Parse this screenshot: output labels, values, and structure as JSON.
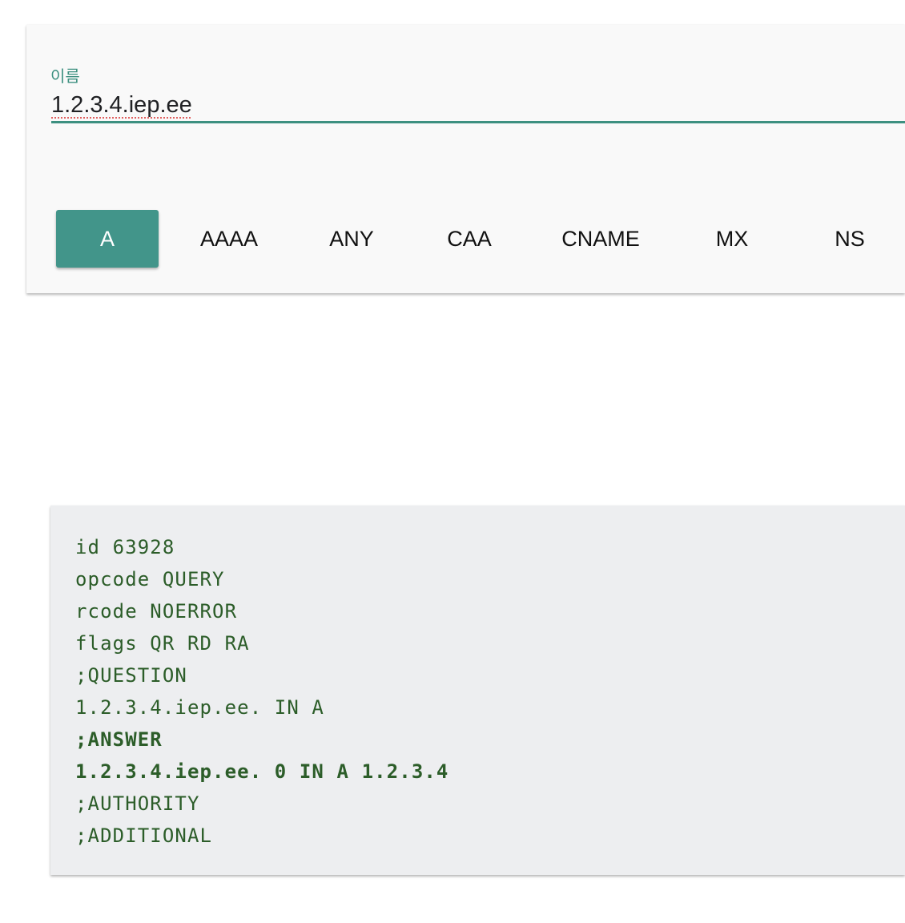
{
  "query_form": {
    "name_label": "이름",
    "name_value": "1.2.3.4.iep.ee",
    "record_types": [
      {
        "label": "A",
        "selected": true
      },
      {
        "label": "AAAA",
        "selected": false
      },
      {
        "label": "ANY",
        "selected": false
      },
      {
        "label": "CAA",
        "selected": false
      },
      {
        "label": "CNAME",
        "selected": false
      },
      {
        "label": "MX",
        "selected": false
      },
      {
        "label": "NS",
        "selected": false
      }
    ]
  },
  "result": {
    "lines": [
      {
        "text": "id 63928",
        "bold": false
      },
      {
        "text": "opcode QUERY",
        "bold": false
      },
      {
        "text": "rcode NOERROR",
        "bold": false
      },
      {
        "text": "flags QR RD RA",
        "bold": false
      },
      {
        "text": ";QUESTION",
        "bold": false
      },
      {
        "text": "1.2.3.4.iep.ee. IN A",
        "bold": false
      },
      {
        "text": ";ANSWER",
        "bold": true
      },
      {
        "text": "1.2.3.4.iep.ee. 0 IN A 1.2.3.4",
        "bold": true
      },
      {
        "text": ";AUTHORITY",
        "bold": false
      },
      {
        "text": ";ADDITIONAL",
        "bold": false
      }
    ]
  },
  "colors": {
    "accent": "#42958a",
    "result_text": "#2c5d29",
    "result_background": "#edeef0"
  }
}
